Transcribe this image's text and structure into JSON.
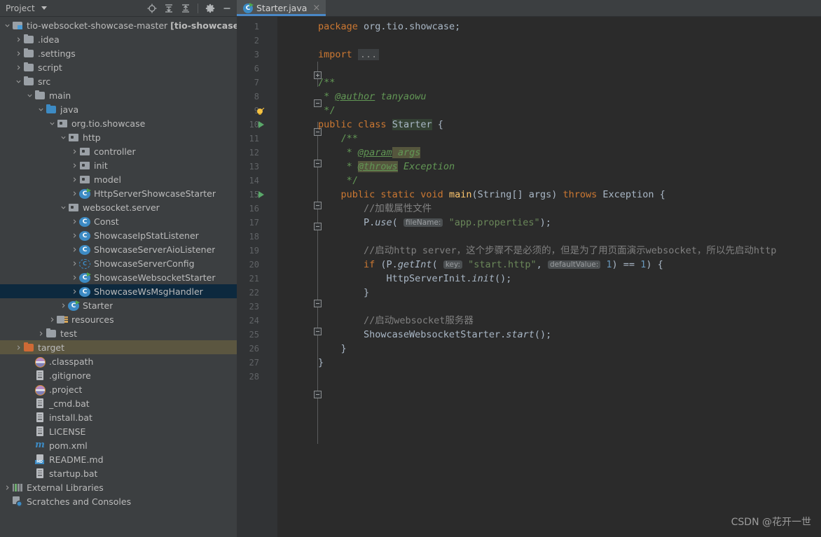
{
  "toolwindow": {
    "title": "Project",
    "caret_icon": "chevron-down-icon",
    "actions": [
      {
        "name": "locate-icon",
        "label": "Select Opened File"
      },
      {
        "name": "expand-all-icon",
        "label": "Expand All"
      },
      {
        "name": "collapse-all-icon",
        "label": "Collapse All"
      },
      {
        "name": "gear-icon",
        "label": "Settings"
      },
      {
        "name": "minimize-icon",
        "label": "Hide"
      }
    ]
  },
  "tabs": [
    {
      "label": "Starter.java",
      "icon": "java-class-run-icon",
      "close": "×",
      "active": true
    }
  ],
  "tree": [
    {
      "indent": 0,
      "arrow": "⌄",
      "icon": "ic-module",
      "label": "tio-websocket-showcase-master ",
      "bold": "[tio-showcase-wel",
      "state": "normal"
    },
    {
      "indent": 1,
      "arrow": "›",
      "icon": "ic-folder",
      "label": ".idea",
      "state": "normal"
    },
    {
      "indent": 1,
      "arrow": "›",
      "icon": "ic-folder",
      "label": ".settings",
      "state": "normal"
    },
    {
      "indent": 1,
      "arrow": "›",
      "icon": "ic-folder",
      "label": "script",
      "state": "normal"
    },
    {
      "indent": 1,
      "arrow": "⌄",
      "icon": "ic-folder",
      "label": "src",
      "state": "normal"
    },
    {
      "indent": 2,
      "arrow": "⌄",
      "icon": "ic-folder",
      "label": "main",
      "state": "normal"
    },
    {
      "indent": 3,
      "arrow": "⌄",
      "icon": "ic-folder-blue",
      "label": "java",
      "state": "normal"
    },
    {
      "indent": 4,
      "arrow": "⌄",
      "icon": "ic-package",
      "label": "org.tio.showcase",
      "state": "normal"
    },
    {
      "indent": 5,
      "arrow": "⌄",
      "icon": "ic-package",
      "label": "http",
      "state": "normal"
    },
    {
      "indent": 6,
      "arrow": "›",
      "icon": "ic-package",
      "label": "controller",
      "state": "normal"
    },
    {
      "indent": 6,
      "arrow": "›",
      "icon": "ic-package",
      "label": "init",
      "state": "normal"
    },
    {
      "indent": 6,
      "arrow": "›",
      "icon": "ic-package",
      "label": "model",
      "state": "normal"
    },
    {
      "indent": 6,
      "arrow": "›",
      "icon": "ic-class-run",
      "label": "HttpServerShowcaseStarter",
      "state": "normal"
    },
    {
      "indent": 5,
      "arrow": "⌄",
      "icon": "ic-package",
      "label": "websocket.server",
      "state": "normal"
    },
    {
      "indent": 6,
      "arrow": "›",
      "icon": "ic-class",
      "label": "Const",
      "state": "normal"
    },
    {
      "indent": 6,
      "arrow": "›",
      "icon": "ic-class",
      "label": "ShowcaseIpStatListener",
      "state": "normal"
    },
    {
      "indent": 6,
      "arrow": "›",
      "icon": "ic-class",
      "label": "ShowcaseServerAioListener",
      "state": "normal"
    },
    {
      "indent": 6,
      "arrow": "›",
      "icon": "ic-class-abs",
      "label": "ShowcaseServerConfig",
      "state": "normal"
    },
    {
      "indent": 6,
      "arrow": "›",
      "icon": "ic-class-run",
      "label": "ShowcaseWebsocketStarter",
      "state": "normal"
    },
    {
      "indent": 6,
      "arrow": "›",
      "icon": "ic-class",
      "label": "ShowcaseWsMsgHandler",
      "state": "selected"
    },
    {
      "indent": 5,
      "arrow": "›",
      "icon": "ic-class-run",
      "label": "Starter",
      "state": "normal"
    },
    {
      "indent": 4,
      "arrow": "›",
      "icon": "ic-resources",
      "label": "resources",
      "state": "normal"
    },
    {
      "indent": 3,
      "arrow": "›",
      "icon": "ic-folder",
      "label": "test",
      "state": "normal"
    },
    {
      "indent": 1,
      "arrow": "›",
      "icon": "ic-folder-orange",
      "label": "target",
      "state": "highlight"
    },
    {
      "indent": 2,
      "arrow": "",
      "icon": "ic-disc",
      "label": ".classpath",
      "state": "normal"
    },
    {
      "indent": 2,
      "arrow": "",
      "icon": "ic-file",
      "label": ".gitignore",
      "state": "normal"
    },
    {
      "indent": 2,
      "arrow": "",
      "icon": "ic-disc",
      "label": ".project",
      "state": "normal"
    },
    {
      "indent": 2,
      "arrow": "",
      "icon": "ic-file",
      "label": "_cmd.bat",
      "state": "normal"
    },
    {
      "indent": 2,
      "arrow": "",
      "icon": "ic-file",
      "label": "install.bat",
      "state": "normal"
    },
    {
      "indent": 2,
      "arrow": "",
      "icon": "ic-file",
      "label": "LICENSE",
      "state": "normal"
    },
    {
      "indent": 2,
      "arrow": "",
      "icon": "ic-maven",
      "label": "pom.xml",
      "state": "normal"
    },
    {
      "indent": 2,
      "arrow": "",
      "icon": "ic-md",
      "label": "README.md",
      "state": "normal"
    },
    {
      "indent": 2,
      "arrow": "",
      "icon": "ic-file",
      "label": "startup.bat",
      "state": "normal"
    },
    {
      "indent": 0,
      "arrow": "›",
      "icon": "ic-lib",
      "label": "External Libraries",
      "state": "normal"
    },
    {
      "indent": 0,
      "arrow": "",
      "icon": "ic-scratch",
      "label": "Scratches and Consoles",
      "state": "normal"
    }
  ],
  "editor": {
    "filename": "Starter.java",
    "gutter_lines": [
      {
        "num": "1",
        "run": false,
        "bulb": false
      },
      {
        "num": "2",
        "run": false,
        "bulb": false
      },
      {
        "num": "3",
        "run": false,
        "bulb": false
      },
      {
        "num": "6",
        "run": false,
        "bulb": false
      },
      {
        "num": "7",
        "run": false,
        "bulb": false
      },
      {
        "num": "8",
        "run": false,
        "bulb": false
      },
      {
        "num": "9",
        "run": false,
        "bulb": true
      },
      {
        "num": "10",
        "run": true,
        "bulb": false
      },
      {
        "num": "11",
        "run": false,
        "bulb": false
      },
      {
        "num": "12",
        "run": false,
        "bulb": false
      },
      {
        "num": "13",
        "run": false,
        "bulb": false
      },
      {
        "num": "14",
        "run": false,
        "bulb": false
      },
      {
        "num": "15",
        "run": true,
        "bulb": false
      },
      {
        "num": "16",
        "run": false,
        "bulb": false
      },
      {
        "num": "17",
        "run": false,
        "bulb": false
      },
      {
        "num": "18",
        "run": false,
        "bulb": false
      },
      {
        "num": "19",
        "run": false,
        "bulb": false
      },
      {
        "num": "20",
        "run": false,
        "bulb": false
      },
      {
        "num": "21",
        "run": false,
        "bulb": false
      },
      {
        "num": "22",
        "run": false,
        "bulb": false
      },
      {
        "num": "23",
        "run": false,
        "bulb": false
      },
      {
        "num": "24",
        "run": false,
        "bulb": false
      },
      {
        "num": "25",
        "run": false,
        "bulb": false
      },
      {
        "num": "26",
        "run": false,
        "bulb": false
      },
      {
        "num": "27",
        "run": false,
        "bulb": false
      },
      {
        "num": "28",
        "run": false,
        "bulb": false
      }
    ],
    "code_plain": [
      "package org.tio.showcase;",
      "",
      "import ...",
      "",
      "/**",
      " * @author tanyaowu",
      " */",
      "public class Starter {",
      "    /**",
      "     * @param args",
      "     * @throws Exception",
      "     */",
      "    public static void main(String[] args) throws Exception {",
      "        //加载属性文件",
      "        P.use( fileName: \"app.properties\");",
      "",
      "        //启动http server，这个步骤不是必须的，但是为了用页面演示websocket，所以先启动http",
      "        if (P.getInt( key: \"start.http\",  defaultValue: 1) == 1) {",
      "            HttpServerInit.init();",
      "        }",
      "",
      "        //启动websocket服务器",
      "        ShowcaseWebsocketStarter.start();",
      "    }",
      "}"
    ]
  },
  "watermark": "CSDN @花开一世",
  "colors": {
    "editor_bg": "#2b2b2b",
    "panel_bg": "#3c3f41",
    "gutter_bg": "#313335",
    "selection": "#0d293e",
    "highlight": "#5b5640",
    "accent": "#4a88c7",
    "keyword": "#cc7832",
    "string": "#6a8759",
    "number": "#6897bb",
    "comment": "#808080",
    "javadoc": "#629755",
    "method": "#ffc66d",
    "text": "#a9b7c6"
  }
}
